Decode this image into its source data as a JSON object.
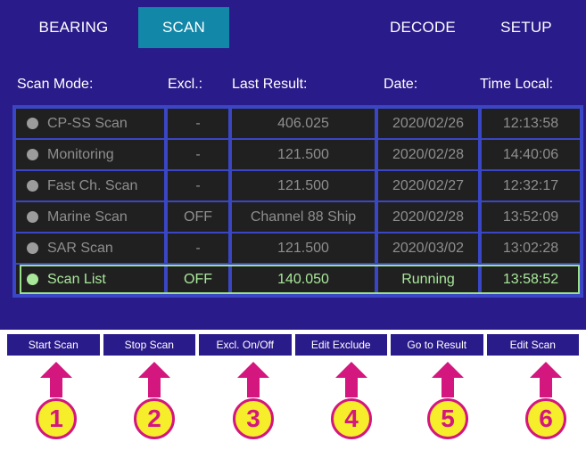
{
  "tabs": [
    {
      "label": "BEARING"
    },
    {
      "label": "SCAN"
    },
    {
      "label": ""
    },
    {
      "label": "DECODE"
    },
    {
      "label": "SETUP"
    }
  ],
  "headers": {
    "scan_mode": "Scan Mode:",
    "excl": "Excl.:",
    "last_result": "Last Result:",
    "date": "Date:",
    "time_local": "Time Local:"
  },
  "rows": [
    {
      "mode": "CP-SS Scan",
      "excl": "-",
      "result": "406.025",
      "date": "2020/02/26",
      "time": "12:13:58"
    },
    {
      "mode": "Monitoring",
      "excl": "-",
      "result": "121.500",
      "date": "2020/02/28",
      "time": "14:40:06"
    },
    {
      "mode": "Fast Ch. Scan",
      "excl": "-",
      "result": "121.500",
      "date": "2020/02/27",
      "time": "12:32:17"
    },
    {
      "mode": "Marine Scan",
      "excl": "OFF",
      "result": "Channel 88 Ship",
      "date": "2020/02/28",
      "time": "13:52:09"
    },
    {
      "mode": "SAR Scan",
      "excl": "-",
      "result": "121.500",
      "date": "2020/03/02",
      "time": "13:02:28"
    },
    {
      "mode": "Scan List",
      "excl": "OFF",
      "result": "140.050",
      "date": "Running",
      "time": "13:58:52"
    }
  ],
  "buttons": [
    {
      "label": "Start Scan"
    },
    {
      "label": "Stop Scan"
    },
    {
      "label": "Excl. On/Off"
    },
    {
      "label": "Edit Exclude"
    },
    {
      "label": "Go to Result"
    },
    {
      "label": "Edit Scan"
    }
  ],
  "badges": [
    "1",
    "2",
    "3",
    "4",
    "5",
    "6"
  ],
  "colors": {
    "screen_bg": "#2a1b8a",
    "active_tab": "#1387a8",
    "active_row": "#a8e89a",
    "badge_fill": "#f6ee2a",
    "badge_accent": "#d4167f"
  }
}
